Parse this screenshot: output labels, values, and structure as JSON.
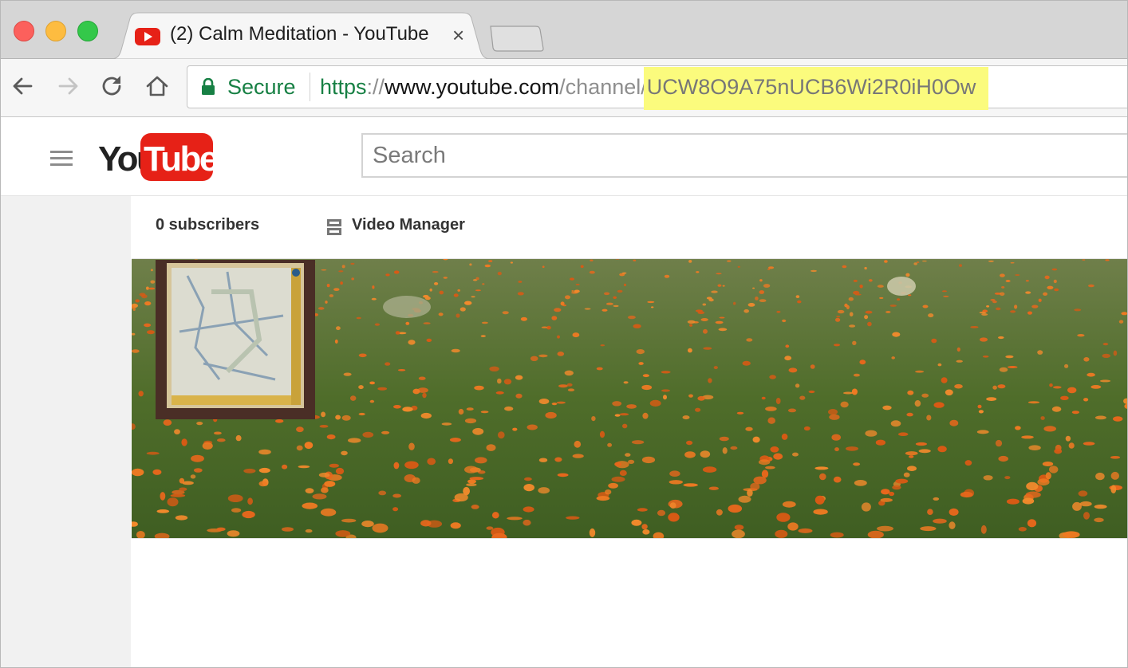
{
  "window": {
    "tab_title": "(2) Calm Meditation - YouTube",
    "tab_close": "×"
  },
  "toolbar": {
    "secure_label": "Secure",
    "url": {
      "scheme": "https",
      "separator": "://",
      "host": "www.youtube.com",
      "path": "/channel/",
      "channel_id": "UCW8O9A75nUCB6Wi2R0iH0Ow"
    },
    "highlight_color": "#fbfb7d"
  },
  "youtube": {
    "logo_you": "You",
    "logo_tube": "Tube",
    "brand_red": "#e62117",
    "search_placeholder": "Search"
  },
  "channel": {
    "subscribers": "0 subscribers",
    "video_manager": "Video Manager"
  },
  "icons": {
    "menu": "hamburger-menu-icon",
    "video_manager": "video-manager-icon",
    "lock": "lock-icon",
    "back": "back-arrow-icon",
    "forward": "forward-arrow-icon",
    "reload": "reload-icon",
    "home": "home-icon"
  }
}
